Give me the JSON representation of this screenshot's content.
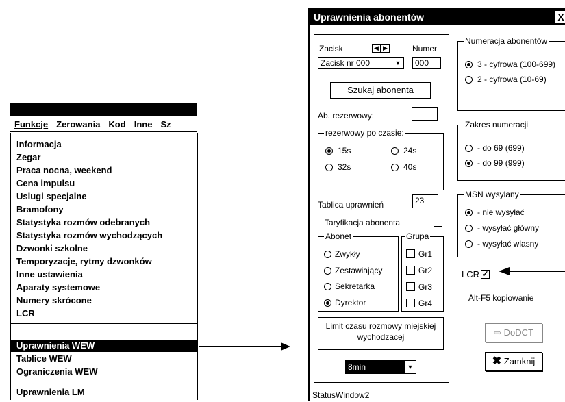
{
  "menu": {
    "bar": [
      "Funkcje",
      "Zerowania",
      "Kod",
      "Inne",
      "Sz"
    ],
    "items": [
      "Informacja",
      "Zegar",
      "Praca nocna,  weekend",
      "Cena impulsu",
      "Uslugi specjalne",
      "Bramofony",
      "Statystyka rozmów odebranych",
      "Statystyka rozmów wychodzących",
      "Dzwonki szkolne",
      "Temporyzacje, rytmy dzwonków",
      "Inne ustawienia",
      "Aparaty systemowe",
      "Numery skrócone",
      "LCR"
    ],
    "items2": [
      "Uprawnienia WEW",
      "Tablice WEW",
      "Ograniczenia WEW"
    ],
    "items3": [
      "Uprawnienia LM"
    ]
  },
  "dialog": {
    "title": "Uprawnienia abonentów",
    "close": "X",
    "zacisk_label": "Zacisk",
    "numer_label": "Numer",
    "zacisk_value": "Zacisk nr 000",
    "numer_value": "000",
    "search_button": "Szukaj abonenta",
    "ab_rezerwowy_label": "Ab. rezerwowy:",
    "ab_rezerwowy_value": "",
    "rezerwowy_group": "rezerwowy po czasie:",
    "rezerwowy_options": [
      "15s",
      "24s",
      "32s",
      "40s"
    ],
    "rezerwowy_selected": "15s",
    "tablica_label": "Tablica uprawnień",
    "tablica_value": "23",
    "taryfikacja_label": "Taryfikacja abonenta",
    "abonent_group": "Abonet",
    "abonent_options": [
      "Zwykły",
      "Zestawiający",
      "Sekretarka",
      "Dyrektor"
    ],
    "abonent_selected": "Dyrektor",
    "grupa_group": "Grupa",
    "grupa_options": [
      "Gr1",
      "Gr2",
      "Gr3",
      "Gr4"
    ],
    "limit_label_1": "Limit czasu rozmowy miejskiej",
    "limit_label_2": "wychodzacej",
    "limit_value": "8min",
    "numeracja_group": "Numeracja abonentów",
    "numeracja_options": [
      "3 - cyfrowa (100-699)",
      "2 - cyfrowa (10-69)"
    ],
    "numeracja_selected": "3 - cyfrowa (100-699)",
    "zakres_group": "Zakres numeracji",
    "zakres_options": [
      "- do 69 (699)",
      "- do 99 (999)"
    ],
    "zakres_selected": "- do 99 (999)",
    "msn_group": "MSN wysylany",
    "msn_options": [
      "- nie wysyłać",
      "- wysyłać główny",
      "- wysyłać wlasny"
    ],
    "msn_selected": "- nie wysyłać",
    "lcr_label": "LCR",
    "lcr_checked": true,
    "alt_label": "Alt-F5 kopiowanie",
    "dodct_button": "DoDCT",
    "close_button": "Zamknij",
    "status": "StatusWindow2"
  }
}
